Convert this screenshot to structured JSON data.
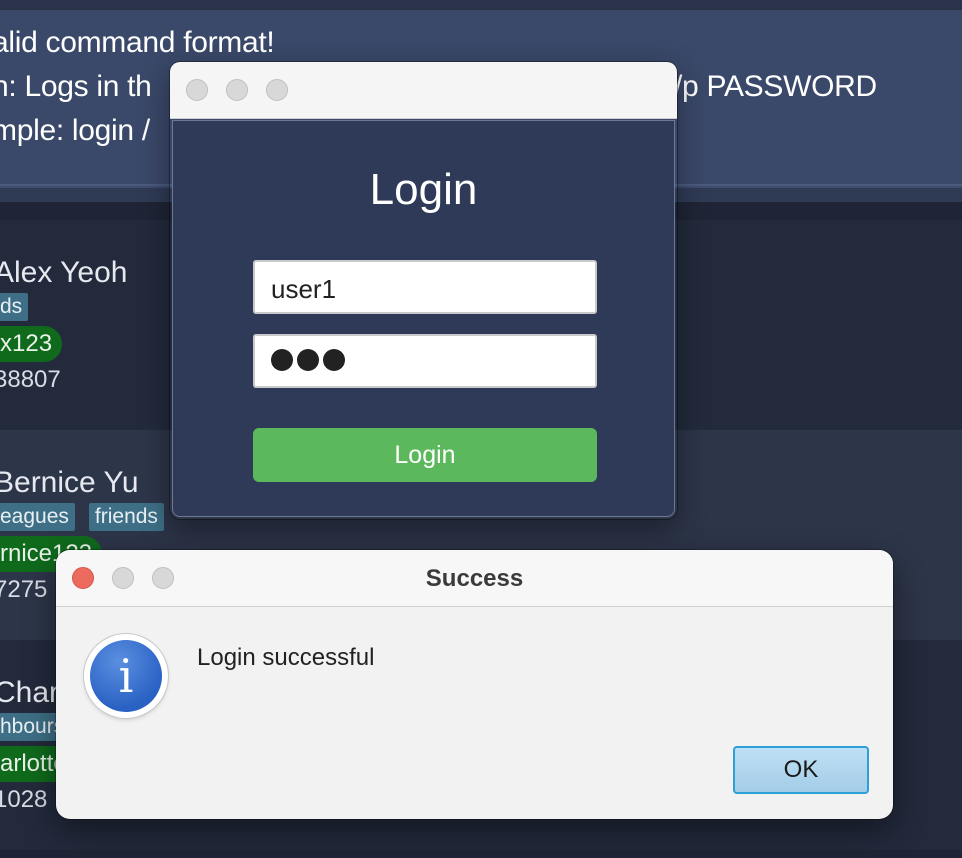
{
  "result": {
    "lines": [
      "alid command format!",
      "n: Logs in th",
      "/p PASSWORD",
      "mple: login /"
    ]
  },
  "persons": [
    {
      "name": "Alex Yeoh",
      "tags": [
        "ds"
      ],
      "handle": "x123",
      "phone": "38807"
    },
    {
      "name": "Bernice Yu",
      "tags": [
        "eagues",
        "friends"
      ],
      "handle": "rnice123",
      "phone": "7275"
    },
    {
      "name": "Char",
      "tags": [
        "hbours"
      ],
      "handle": "arlotte",
      "phone": "1028"
    }
  ],
  "login_window": {
    "heading": "Login",
    "username_value": "user1",
    "password_mask_count": 3,
    "button_label": "Login",
    "button_color": "#5cb85c"
  },
  "success_dialog": {
    "title": "Success",
    "message": "Login successful",
    "ok_label": "OK",
    "icon": "info-icon",
    "icon_glyph": "i"
  }
}
